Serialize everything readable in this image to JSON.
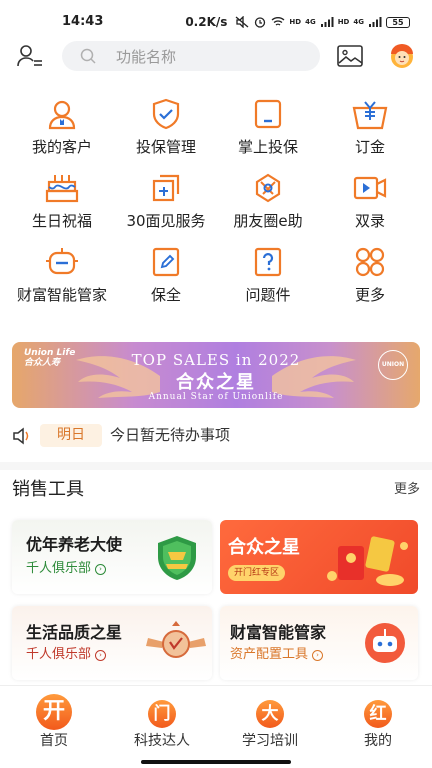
{
  "status_bar": {
    "time": "14:43",
    "network_speed": "0.2K/s",
    "battery": "55",
    "net_badge_1": "HD",
    "net_badge_2": "4G",
    "net_badge_3": "HD",
    "net_badge_4": "4G"
  },
  "top_bar": {
    "search_placeholder": "功能名称"
  },
  "grid": {
    "items": [
      {
        "label": "我的客户",
        "icon": "customer-icon"
      },
      {
        "label": "投保管理",
        "icon": "shield-check-icon"
      },
      {
        "label": "掌上投保",
        "icon": "tablet-icon"
      },
      {
        "label": "订金",
        "icon": "yen-deposit-icon"
      },
      {
        "label": "生日祝福",
        "icon": "birthday-cake-icon"
      },
      {
        "label": "30面见服务",
        "icon": "meeting-service-icon"
      },
      {
        "label": "朋友圈e助",
        "icon": "camera-aperture-icon"
      },
      {
        "label": "双录",
        "icon": "video-record-icon"
      },
      {
        "label": "财富智能管家",
        "icon": "robot-icon"
      },
      {
        "label": "保全",
        "icon": "edit-doc-icon"
      },
      {
        "label": "问题件",
        "icon": "question-doc-icon"
      },
      {
        "label": "更多",
        "icon": "more-grid-icon"
      }
    ]
  },
  "banner": {
    "brand_en": "Union Life",
    "brand_cn": "合众人寿",
    "title": "TOP SALES in 2022",
    "main": "合众之星",
    "sub": "Annual Star of Unionlife",
    "badge": "UNION"
  },
  "todo": {
    "tag": "明日",
    "text": "今日暂无待办事项"
  },
  "sales_tools": {
    "title": "销售工具",
    "more": "更多",
    "cards": [
      {
        "title": "优年养老大使",
        "sub": "千人俱乐部",
        "sub_color": "#2e8b3a"
      },
      {
        "title": "合众之星",
        "button": "开门红专区"
      },
      {
        "title": "生活品质之星",
        "sub": "千人俱乐部",
        "sub_color": "#c0392b"
      },
      {
        "title": "财富智能管家",
        "sub": "资产配置工具",
        "sub_color": "#d9772a"
      }
    ]
  },
  "bottom_nav": {
    "items": [
      {
        "badge": "开",
        "label": "首页"
      },
      {
        "badge": "门",
        "label": "科技达人"
      },
      {
        "badge": "大",
        "label": "学习培训"
      },
      {
        "badge": "红",
        "label": "我的"
      }
    ]
  },
  "colors": {
    "accent": "#f07a28",
    "accent_dark": "#d9772a",
    "icon_blue": "#2b6fd6"
  }
}
